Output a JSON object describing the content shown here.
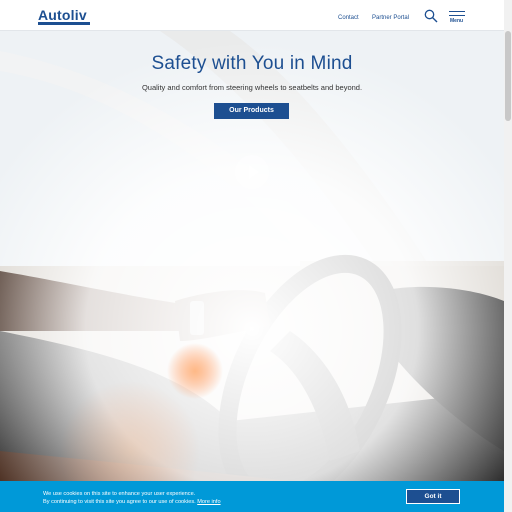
{
  "header": {
    "logo": "Autoliv",
    "nav": {
      "contact": "Contact",
      "partner_portal": "Partner Portal",
      "menu": "Menu"
    },
    "icons": {
      "search": "search-icon",
      "menu": "hamburger-menu-icon"
    }
  },
  "hero": {
    "title": "Safety with You in Mind",
    "subtitle": "Quality and comfort from steering wheels to seatbelts and beyond.",
    "cta_label": "Our Products",
    "play_icon": "play-icon"
  },
  "cookie_banner": {
    "line1": "We use cookies on this site to enhance your user experience.",
    "line2": "By continuing to visit this site you agree to our use of cookies.",
    "link": "More info",
    "button": "Got it"
  },
  "colors": {
    "brand_blue": "#1d4f91",
    "cookie_bar": "#0099d8",
    "white": "#ffffff"
  }
}
